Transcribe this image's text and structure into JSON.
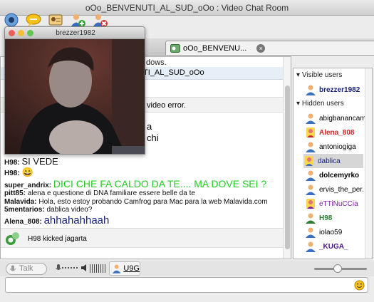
{
  "window": {
    "title": "oOo_BENVENUTI_AL_SUD_oOo : Video Chat Room"
  },
  "toolbar": {
    "icons": [
      "camera-icon",
      "chat-bubble-icon",
      "contact-card-icon",
      "add-user-icon",
      "remove-user-icon"
    ]
  },
  "tab": {
    "label": "oOo_BENVENU..."
  },
  "video": {
    "username": "brezzer1982"
  },
  "chat": {
    "notice_fragment": "dows.",
    "room_fragment": "TI_AL_SUD_oOo",
    "error_fragment": "video error.",
    "partial_line1": "a",
    "partial_line2": "chi",
    "messages": [
      {
        "nick": "H98:",
        "text": "SI VEDE",
        "style": "big"
      },
      {
        "nick": "H98:",
        "text": "😄",
        "style": "big"
      },
      {
        "nick": "super_andrix:",
        "text": "DICI CHE FA CALDO DA TE.... MA DOVE SEI ?",
        "style": "green"
      },
      {
        "nick": "pitt85:",
        "text": "alena e questione di DNA familiare essere belle da te",
        "style": "normal"
      },
      {
        "nick": "Malavida:",
        "text": "Hola, esto estoy probando Camfrog para Mac para la web Malavida.com",
        "style": "normal"
      },
      {
        "nick": "5mentarios:",
        "text": "dablica video?",
        "style": "normal"
      },
      {
        "nick": "Alena_808:",
        "text": "ahhahahhaah",
        "style": "navy"
      }
    ],
    "kick_notice": "H98 kicked jagarta"
  },
  "users": {
    "visible_header": "Visible users",
    "hidden_header": "Hidden users",
    "visible": [
      {
        "name": "brezzer1982",
        "color": "#1a237e",
        "bold": true,
        "avatar": "person-icon"
      }
    ],
    "hidden": [
      {
        "name": "abigbanancam",
        "color": "#111111",
        "bold": false,
        "avatar": "person-icon"
      },
      {
        "name": "Alena_808",
        "color": "#c62828",
        "bold": true,
        "avatar": "person-icon"
      },
      {
        "name": "antoniogiga",
        "color": "#111111",
        "bold": false,
        "avatar": "person-icon"
      },
      {
        "name": "dablica",
        "color": "#1a237e",
        "bold": false,
        "avatar": "person-icon",
        "selected": true
      },
      {
        "name": "dolcemyrko",
        "color": "#111111",
        "bold": true,
        "avatar": "person-icon"
      },
      {
        "name": "ervis_the_per.",
        "color": "#111111",
        "bold": false,
        "avatar": "person-icon"
      },
      {
        "name": "eTTiNuCCia",
        "color": "#7b1fa2",
        "bold": false,
        "avatar": "person-icon"
      },
      {
        "name": "H98",
        "color": "#2e7d32",
        "bold": true,
        "avatar": "person-icon"
      },
      {
        "name": "iolao59",
        "color": "#111111",
        "bold": false,
        "avatar": "person-icon"
      },
      {
        "name": "_KUGA_",
        "color": "#4a148c",
        "bold": true,
        "avatar": "person-icon"
      }
    ]
  },
  "bottom": {
    "talk_label": "Talk",
    "user_label": "U9G"
  },
  "input": {
    "value": "",
    "placeholder": ""
  },
  "colors": {
    "accent_green": "#22cc22",
    "accent_navy": "#1a237e"
  }
}
